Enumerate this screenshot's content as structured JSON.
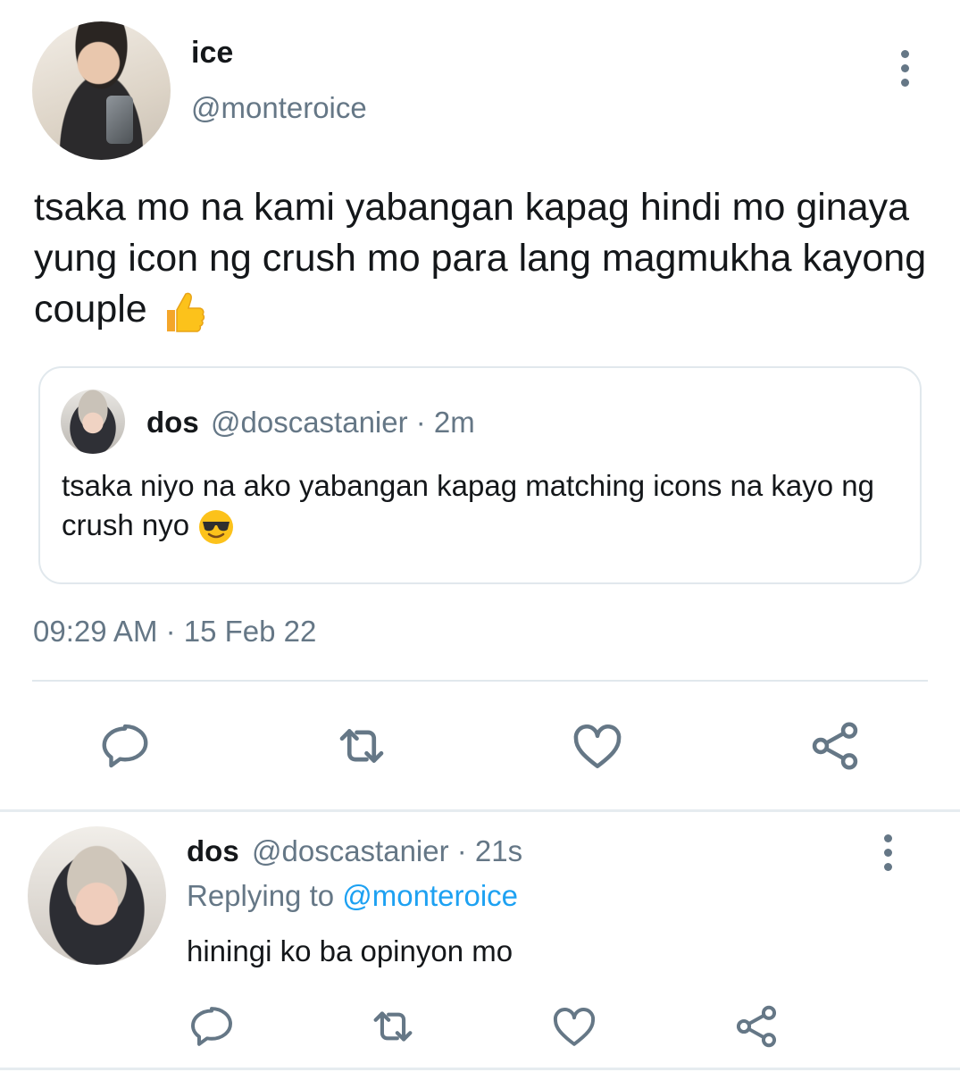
{
  "tweet": {
    "author_name": "ice",
    "author_handle": "@monteroice",
    "text": "tsaka mo na kami yabangan kapag hindi mo ginaya yung icon ng crush mo para lang magmukha kayong couple",
    "text_emoji": "thumbs-up",
    "timestamp": "09:29 AM · 15 Feb 22"
  },
  "quote": {
    "author_name": "dos",
    "author_meta": "@doscastanier · 2m",
    "text": "tsaka niyo na ako yabangan kapag matching icons na kayo ng crush nyo",
    "text_emoji": "sunglasses-face"
  },
  "reply": {
    "author_name": "dos",
    "author_meta": "@doscastanier · 21s",
    "replying_prefix": "Replying to",
    "replying_to": "@monteroice",
    "text": "hiningi ko ba opinyon mo"
  },
  "icons": {
    "actions": [
      "comment-icon",
      "retweet-icon",
      "like-icon",
      "share-icon"
    ],
    "menu": "more-options-icon"
  },
  "colors": {
    "text": "#14171a",
    "muted": "#657786",
    "link": "#1da1f2",
    "border": "#e1e8ed"
  }
}
